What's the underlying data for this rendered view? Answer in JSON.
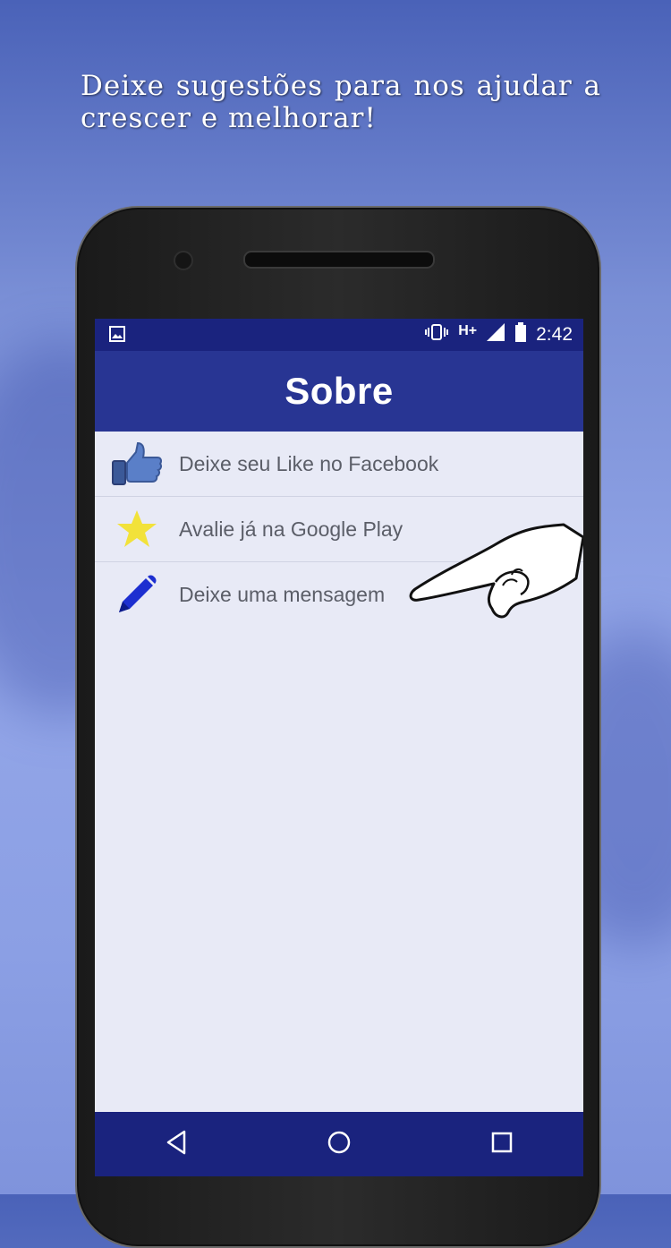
{
  "promo": {
    "text": "Deixe sugestões para nos ajudar a crescer e melhorar!"
  },
  "status": {
    "network": "H+",
    "time": "2:42"
  },
  "appbar": {
    "title": "Sobre"
  },
  "menu": {
    "items": [
      {
        "label": "Deixe seu Like no Facebook",
        "icon": "thumbs-up-icon"
      },
      {
        "label": "Avalie já na Google Play",
        "icon": "star-icon"
      },
      {
        "label": "Deixe uma mensagem",
        "icon": "pencil-icon"
      }
    ]
  },
  "navbar": {
    "buttons": [
      "back-icon",
      "home-icon",
      "recents-icon"
    ]
  },
  "colors": {
    "status_bar": "#1a237e",
    "app_bar": "#283593",
    "screen_bg": "#e8eaf6",
    "star": "#f2e23a",
    "pencil": "#1d2fd0"
  }
}
